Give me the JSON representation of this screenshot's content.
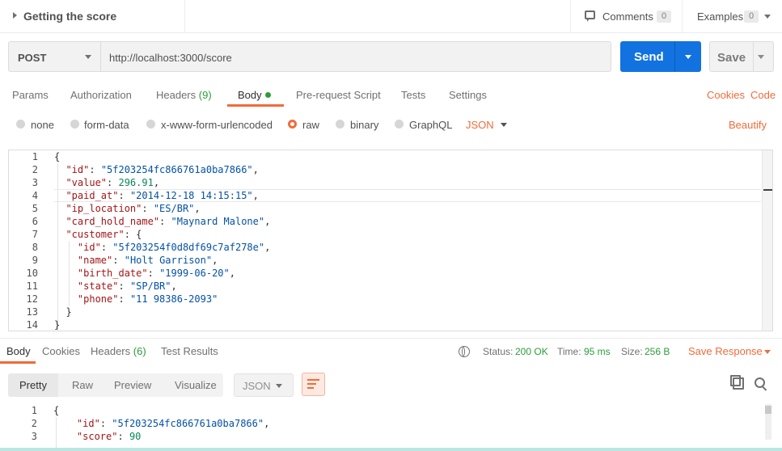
{
  "request": {
    "title": "Getting the score",
    "method": "POST",
    "url": "http://localhost:3000/score",
    "send_label": "Send",
    "save_label": "Save"
  },
  "header": {
    "comments_label": "Comments",
    "comments_count": "0",
    "examples_label": "Examples",
    "examples_count": "0"
  },
  "request_tabs": {
    "params": "Params",
    "authorization": "Authorization",
    "headers": "Headers",
    "headers_count": "(9)",
    "body": "Body",
    "prerequest": "Pre-request Script",
    "tests": "Tests",
    "settings": "Settings",
    "cookies": "Cookies",
    "code": "Code"
  },
  "body_types": {
    "none": "none",
    "form_data": "form-data",
    "urlencoded": "x-www-form-urlencoded",
    "raw": "raw",
    "binary": "binary",
    "graphql": "GraphQL",
    "format": "JSON",
    "beautify": "Beautify"
  },
  "editor": {
    "line_numbers": [
      "1",
      "2",
      "3",
      "4",
      "5",
      "6",
      "7",
      "8",
      "9",
      "10",
      "11",
      "12",
      "13",
      "14"
    ],
    "lines": {
      "l1": "{",
      "l2_key": "\"id\"",
      "l2_val": "\"5f203254fc866761a0ba7866\"",
      "l3_key": "\"value\"",
      "l3_val": "296.91",
      "l4_key": "\"paid_at\"",
      "l4_val": "\"2014-12-18 14:15:15\"",
      "l5_key": "\"ip_location\"",
      "l5_val": "\"ES/BR\"",
      "l6_key": "\"card_hold_name\"",
      "l6_val": "\"Maynard Malone\"",
      "l7_key": "\"customer\"",
      "l7_rest": "{",
      "l8_key": "\"id\"",
      "l8_val": "\"5f203254f0d8df69c7af278e\"",
      "l9_key": "\"name\"",
      "l9_val": "\"Holt Garrison\"",
      "l10_key": "\"birth_date\"",
      "l10_val": "\"1999-06-20\"",
      "l11_key": "\"state\"",
      "l11_val": "\"SP/BR\"",
      "l12_key": "\"phone\"",
      "l12_val": "\"11 98386-2093\"",
      "l13": "}",
      "l14": "}"
    }
  },
  "response": {
    "tabs": {
      "body": "Body",
      "cookies": "Cookies",
      "headers": "Headers",
      "headers_count": "(6)",
      "test_results": "Test Results"
    },
    "status_label": "Status:",
    "status_value": "200 OK",
    "time_label": "Time:",
    "time_value": "95 ms",
    "size_label": "Size:",
    "size_value": "256 B",
    "save_response": "Save Response",
    "views": {
      "pretty": "Pretty",
      "raw": "Raw",
      "preview": "Preview",
      "visualize": "Visualize"
    },
    "format": "JSON",
    "line_numbers": [
      "1",
      "2",
      "3"
    ],
    "lines": {
      "l1": "{",
      "l2_key": "\"id\"",
      "l2_val": "\"5f203254fc866761a0ba7866\"",
      "l3_key": "\"score\"",
      "l3_val": "90"
    }
  },
  "colors": {
    "accent": "#f26b3a",
    "send_button": "#1272e0",
    "status_ok": "#2a9d3a"
  }
}
